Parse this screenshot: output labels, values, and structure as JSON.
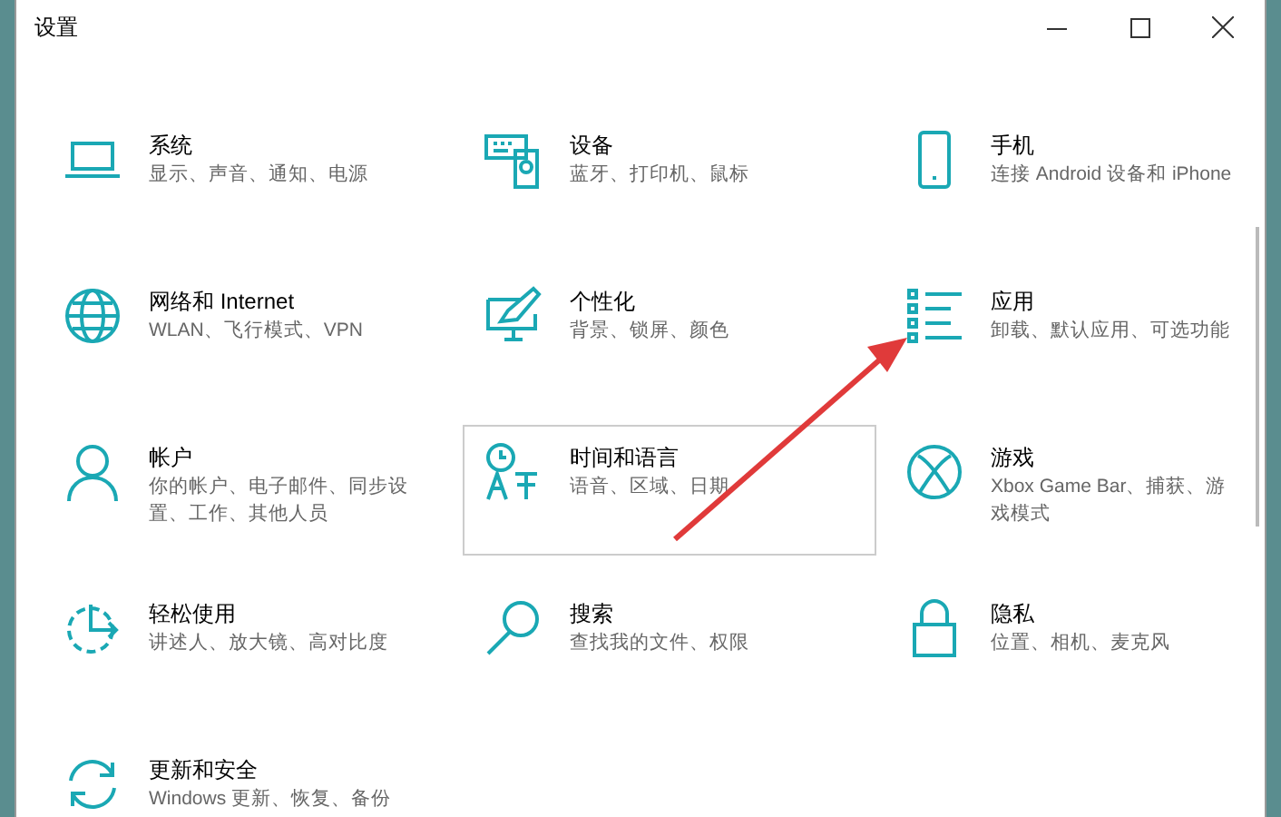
{
  "window": {
    "title": "设置"
  },
  "items": [
    {
      "kind": "laptop",
      "title": "系统",
      "subtitle": "显示、声音、通知、电源",
      "selected": false
    },
    {
      "kind": "keyboard",
      "title": "设备",
      "subtitle": "蓝牙、打印机、鼠标",
      "selected": false
    },
    {
      "kind": "phone",
      "title": "手机",
      "subtitle": "连接 Android 设备和 iPhone",
      "selected": false
    },
    {
      "kind": "globe",
      "title": "网络和 Internet",
      "subtitle": "WLAN、飞行模式、VPN",
      "selected": false
    },
    {
      "kind": "paint",
      "title": "个性化",
      "subtitle": "背景、锁屏、颜色",
      "selected": false
    },
    {
      "kind": "list",
      "title": "应用",
      "subtitle": "卸载、默认应用、可选功能",
      "selected": false
    },
    {
      "kind": "person",
      "title": "帐户",
      "subtitle": "你的帐户、电子邮件、同步设置、工作、其他人员",
      "selected": false
    },
    {
      "kind": "language",
      "title": "时间和语言",
      "subtitle": "语音、区域、日期",
      "selected": true
    },
    {
      "kind": "xbox",
      "title": "游戏",
      "subtitle": "Xbox Game Bar、捕获、游戏模式",
      "selected": false
    },
    {
      "kind": "ease",
      "title": "轻松使用",
      "subtitle": "讲述人、放大镜、高对比度",
      "selected": false
    },
    {
      "kind": "search",
      "title": "搜索",
      "subtitle": "查找我的文件、权限",
      "selected": false
    },
    {
      "kind": "lock",
      "title": "隐私",
      "subtitle": "位置、相机、麦克风",
      "selected": false
    },
    {
      "kind": "update",
      "title": "更新和安全",
      "subtitle": "Windows 更新、恢复、备份",
      "selected": false
    }
  ]
}
